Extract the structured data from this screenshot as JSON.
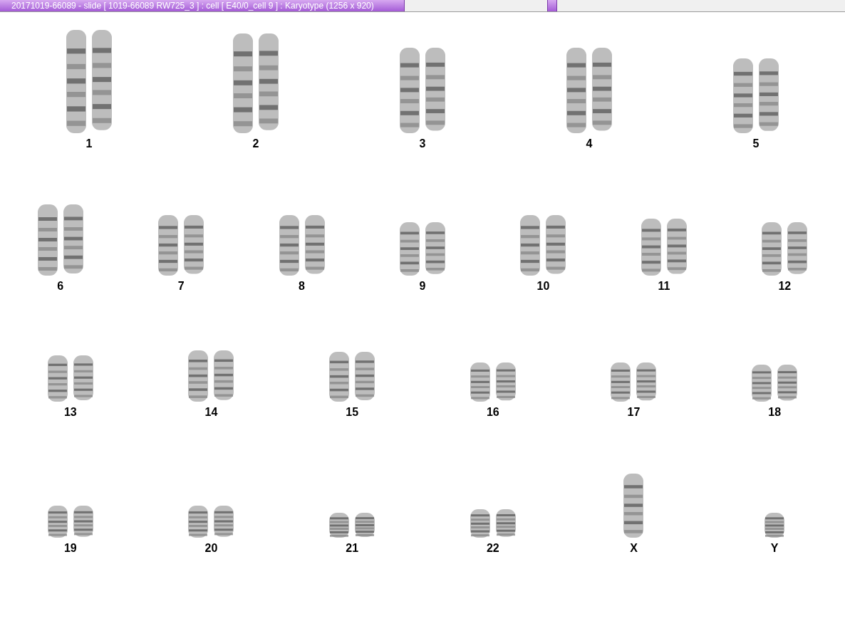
{
  "title_tab": "20171019-66089 - slide [ 1019-66089 RW725_3 ] : cell [ E40/0_cell 9 ] : Karyotype  (1256 x 920)",
  "rows": [
    {
      "chromosomes": [
        {
          "label": "1",
          "kind": "pair"
        },
        {
          "label": "2",
          "kind": "pair"
        },
        {
          "label": "3",
          "kind": "pair"
        },
        {
          "label": "4",
          "kind": "pair"
        },
        {
          "label": "5",
          "kind": "pair"
        }
      ]
    },
    {
      "chromosomes": [
        {
          "label": "6",
          "kind": "pair"
        },
        {
          "label": "7",
          "kind": "pair"
        },
        {
          "label": "8",
          "kind": "pair"
        },
        {
          "label": "9",
          "kind": "pair"
        },
        {
          "label": "10",
          "kind": "pair"
        },
        {
          "label": "11",
          "kind": "pair"
        },
        {
          "label": "12",
          "kind": "pair"
        }
      ]
    },
    {
      "chromosomes": [
        {
          "label": "13",
          "kind": "pair"
        },
        {
          "label": "14",
          "kind": "pair"
        },
        {
          "label": "15",
          "kind": "pair"
        },
        {
          "label": "16",
          "kind": "pair"
        },
        {
          "label": "17",
          "kind": "pair"
        },
        {
          "label": "18",
          "kind": "pair"
        }
      ]
    },
    {
      "chromosomes": [
        {
          "label": "19",
          "kind": "pair"
        },
        {
          "label": "20",
          "kind": "pair"
        },
        {
          "label": "21",
          "kind": "pair"
        },
        {
          "label": "22",
          "kind": "pair"
        },
        {
          "label": "X",
          "kind": "single"
        },
        {
          "label": "Y",
          "kind": "single"
        }
      ]
    }
  ]
}
